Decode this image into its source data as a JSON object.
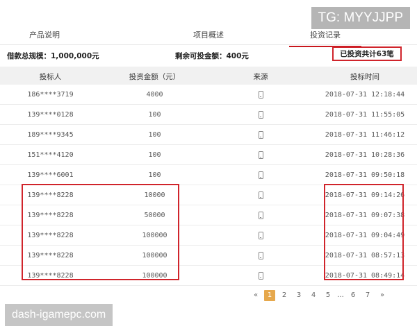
{
  "tabs": [
    {
      "label": "产品说明"
    },
    {
      "label": "项目概述"
    },
    {
      "label": "投资记录"
    }
  ],
  "summary": {
    "loan_total": "借款总规模：1,000,000元",
    "remaining": "剩余可投金额：400元",
    "invest_count": "已投资共计63笔"
  },
  "table": {
    "headers": [
      "投标人",
      "投资金额（元）",
      "来源",
      "投标时间"
    ],
    "rows": [
      {
        "investor": "186****3719",
        "amount": "4000",
        "source_icon": "mobile-phone-icon",
        "time": "2018-07-31 12:18:44"
      },
      {
        "investor": "139****0128",
        "amount": "100",
        "source_icon": "mobile-phone-icon",
        "time": "2018-07-31 11:55:05"
      },
      {
        "investor": "189****9345",
        "amount": "100",
        "source_icon": "mobile-phone-icon",
        "time": "2018-07-31 11:46:12"
      },
      {
        "investor": "151****4120",
        "amount": "100",
        "source_icon": "mobile-phone-icon",
        "time": "2018-07-31 10:28:36"
      },
      {
        "investor": "139****6001",
        "amount": "100",
        "source_icon": "mobile-phone-icon",
        "time": "2018-07-31 09:50:18"
      },
      {
        "investor": "139****8228",
        "amount": "10000",
        "source_icon": "mobile-phone-icon",
        "time": "2018-07-31 09:14:26"
      },
      {
        "investor": "139****8228",
        "amount": "50000",
        "source_icon": "mobile-phone-icon",
        "time": "2018-07-31 09:07:38"
      },
      {
        "investor": "139****8228",
        "amount": "100000",
        "source_icon": "mobile-phone-icon",
        "time": "2018-07-31 09:04:49"
      },
      {
        "investor": "139****8228",
        "amount": "100000",
        "source_icon": "mobile-phone-icon",
        "time": "2018-07-31 08:57:13"
      },
      {
        "investor": "139****8228",
        "amount": "100000",
        "source_icon": "mobile-phone-icon",
        "time": "2018-07-31 08:49:14"
      }
    ]
  },
  "pagination": {
    "prev": "«",
    "pages": [
      "1",
      "2",
      "3",
      "4",
      "5",
      "...",
      "6",
      "7"
    ],
    "current": "1",
    "next": "»"
  },
  "watermarks": {
    "tg": "TG: MYYJJPP",
    "site": "dash-igamepc.com"
  },
  "colors": {
    "highlight": "#d0242b",
    "active_tab": "#c8161d",
    "active_page": "#e6a84c"
  }
}
